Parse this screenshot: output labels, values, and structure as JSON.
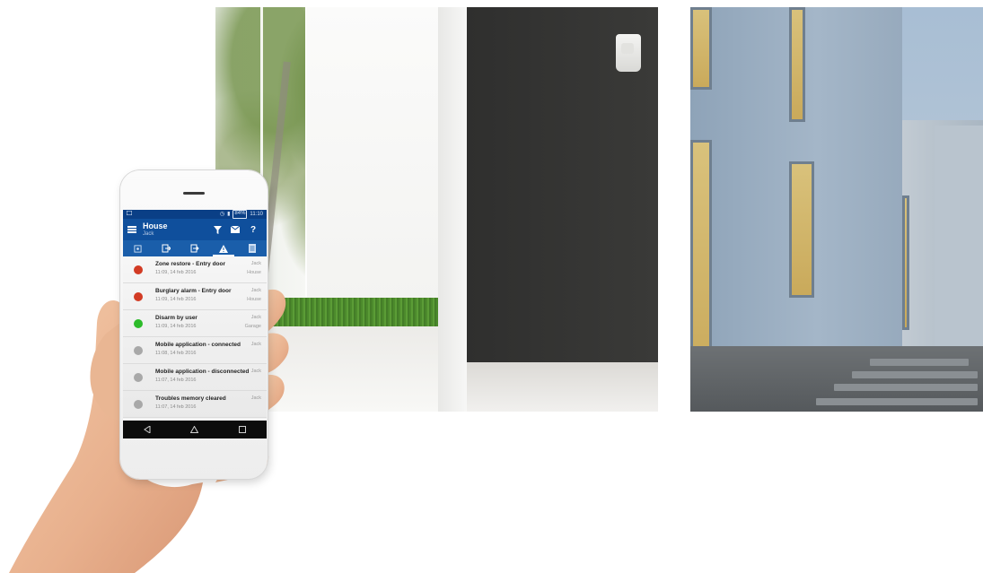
{
  "colors": {
    "app_bar": "#0f4f9c",
    "status_bar": "#0a3f86",
    "toolbar": "#1a5eaa",
    "event_red": "#d23b24",
    "event_green": "#2dbb2a",
    "event_grey": "#a8a8a8"
  },
  "statusbar": {
    "left_icon": "notification-icon",
    "battery": "84%",
    "time": "11:10"
  },
  "appbar": {
    "title": "House",
    "subtitle": "Jack",
    "actions": [
      "filter-icon",
      "mail-icon",
      "help-icon"
    ],
    "help_label": "?"
  },
  "toolbar": {
    "items": [
      {
        "icon": "arm-icon"
      },
      {
        "icon": "exit-icon"
      },
      {
        "icon": "enter-icon"
      },
      {
        "icon": "warning-icon",
        "active": true
      },
      {
        "icon": "list-icon"
      }
    ]
  },
  "events": [
    {
      "title": "Zone restore - Entry door",
      "time": "11:09, 14 feb 2016",
      "user": "Jack",
      "place": "House",
      "status": "red"
    },
    {
      "title": "Burglary alarm - Entry door",
      "time": "11:09, 14 feb 2016",
      "user": "Jack",
      "place": "House",
      "status": "red"
    },
    {
      "title": "Disarm by user",
      "time": "11:09, 14 feb 2016",
      "user": "Jack",
      "place": "Garage",
      "status": "green"
    },
    {
      "title": "Mobile application - connected",
      "time": "11:08, 14 feb 2016",
      "user": "Jack",
      "place": "",
      "status": "grey"
    },
    {
      "title": "Mobile application - disconnected",
      "time": "11:07, 14 feb 2016",
      "user": "Jack",
      "place": "",
      "status": "grey"
    },
    {
      "title": "Troubles memory cleared",
      "time": "11:07, 14 feb 2016",
      "user": "Jack",
      "place": "",
      "status": "grey"
    }
  ],
  "navbar": {
    "items": [
      "back-icon",
      "home-icon",
      "recents-icon"
    ]
  },
  "images": {
    "interior": "interior-photo",
    "exterior": "exterior-photo",
    "hand": "hand-holding-phone"
  }
}
